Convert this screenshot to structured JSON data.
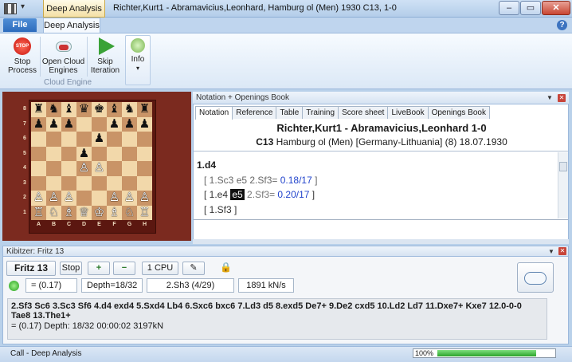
{
  "window": {
    "context_tab": "Deep Analysis",
    "title": "Richter,Kurt1 - Abramavicius,Leonhard, Hamburg ol (Men) 1930  C13, 1-0",
    "controls": {
      "minimize": "–",
      "maximize": "▭",
      "close": "✕"
    }
  },
  "ribbon": {
    "tabs": [
      {
        "label": "File"
      },
      {
        "label": "Deep Analysis"
      }
    ],
    "buttons": {
      "stop": "Stop Process",
      "cloud": "Open Cloud Engines",
      "skip": "Skip Iteration",
      "info": "Info"
    },
    "stop_icon_text": "STOP",
    "group_label": "Cloud Engine",
    "help": "?"
  },
  "board": {
    "ranks": [
      "8",
      "7",
      "6",
      "5",
      "4",
      "3",
      "2",
      "1"
    ],
    "files": [
      "A",
      "B",
      "C",
      "D",
      "E",
      "F",
      "G",
      "H"
    ],
    "position": [
      [
        "♜",
        "♞",
        "♝",
        "♛",
        "♚",
        "♝",
        "♞",
        "♜"
      ],
      [
        "♟",
        "♟",
        "♟",
        "",
        "",
        "♟",
        "♟",
        "♟"
      ],
      [
        "",
        "",
        "",
        "",
        "♟",
        "",
        "",
        ""
      ],
      [
        "",
        "",
        "",
        "♟",
        "",
        "",
        "",
        ""
      ],
      [
        "",
        "",
        "",
        "♙",
        "♙",
        "",
        "",
        ""
      ],
      [
        "",
        "",
        "",
        "",
        "",
        "",
        "",
        ""
      ],
      [
        "♙",
        "♙",
        "♙",
        "",
        "",
        "♙",
        "♙",
        "♙"
      ],
      [
        "♖",
        "♘",
        "♗",
        "♕",
        "♔",
        "♗",
        "♘",
        "♖"
      ]
    ]
  },
  "notation": {
    "panel_title": "Notation + Openings Book",
    "tabs": [
      "Notation",
      "Reference",
      "Table",
      "Training",
      "Score sheet",
      "LiveBook",
      "Openings Book"
    ],
    "active_tab": "Notation",
    "players": "Richter,Kurt1 - Abramavicius,Leonhard  1-0",
    "eco": "C13",
    "event": " Hamburg ol (Men) [Germany-Lithuania] (8) 18.07.1930",
    "main_move": "1.d4",
    "variations": [
      {
        "moves": "[ 1.Sc3  e5  2.Sf3=",
        "eval": " 0.18/17",
        "close": " ]"
      },
      {
        "pre": "[ 1.e4 ",
        "highlight": "e5",
        "post": " 2.Sf3=",
        "eval": " 0.20/17",
        "close": " ]"
      },
      {
        "moves": "[ 1.Sf3 ]"
      }
    ]
  },
  "kibitzer": {
    "panel_title": "Kibitzer: Fritz 13",
    "engine": "Fritz 13",
    "stop": "Stop",
    "zoom_in": "+",
    "zoom_out": "−",
    "cpu": "1 CPU",
    "edit": "✎",
    "lock": "🔒",
    "eval": "=  (0.17)",
    "depth": "Depth=18/32",
    "best": "2.Sh3 (4/29)",
    "speed": "1891 kN/s",
    "pv": "2.Sf3 Sc6 3.Sc3 Sf6 4.d4 exd4 5.Sxd4 Lb4 6.Sxc6 bxc6 7.Ld3 d5 8.exd5 De7+ 9.De2 cxd5 10.Ld2 Ld7 11.Dxe7+ Kxe7 12.0-0-0 Tae8 13.The1+",
    "pv_stats": "=  (0.17)   Depth: 18/32   00:00:02  3197kN"
  },
  "statusbar": {
    "text": "Call - Deep Analysis",
    "progress_label": "100%",
    "progress": 1.0
  },
  "colors": {
    "accent": "#2d6cbd",
    "eval_blue": "#2244cc",
    "board_light": "#f2d8aa",
    "board_dark": "#c99467"
  }
}
